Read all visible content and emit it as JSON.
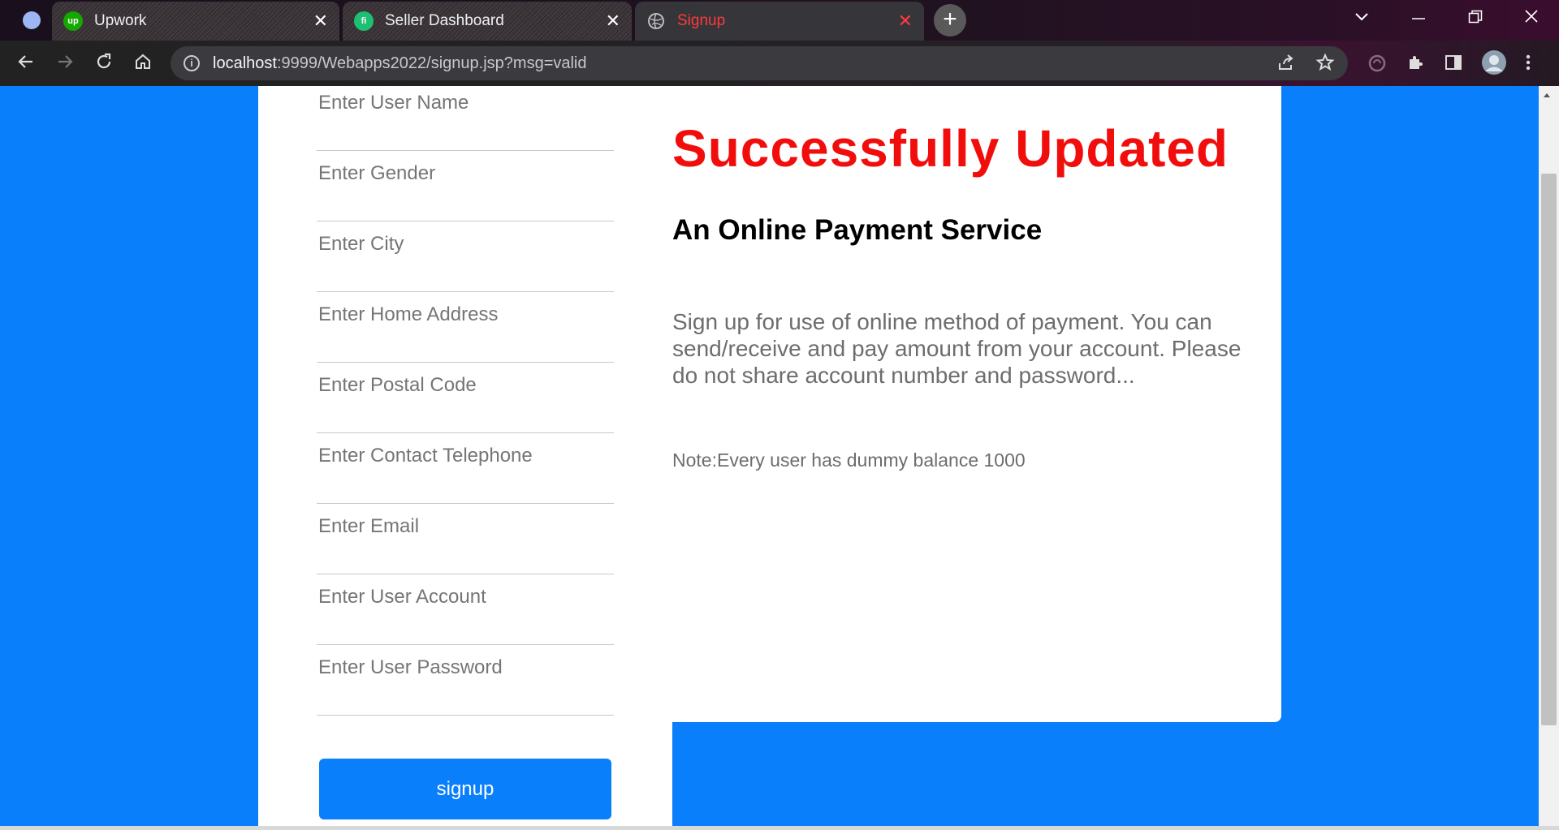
{
  "browser": {
    "tabs": [
      {
        "title": "Upwork",
        "favicon": "up"
      },
      {
        "title": "Seller Dashboard",
        "favicon": "fi"
      },
      {
        "title": "Signup",
        "favicon": "globe-icon"
      }
    ],
    "url_host": "localhost",
    "url_rest": ":9999/Webapps2022/signup.jsp?msg=valid",
    "tab_close_glyph": "✕",
    "new_tab_glyph": "+"
  },
  "form": {
    "fields": [
      {
        "placeholder": "Enter User Name"
      },
      {
        "placeholder": "Enter Gender"
      },
      {
        "placeholder": "Enter City"
      },
      {
        "placeholder": "Enter Home Address"
      },
      {
        "placeholder": "Enter Postal Code"
      },
      {
        "placeholder": "Enter Contact Telephone"
      },
      {
        "placeholder": "Enter Email"
      },
      {
        "placeholder": "Enter User Account"
      },
      {
        "placeholder": "Enter User Password"
      }
    ],
    "submit_label": "signup"
  },
  "info": {
    "status_heading": "Successfully Updated",
    "service_title": "An Online Payment Service",
    "description": "Sign up for use of online method of payment. You can send/receive and pay amount from your account. Please do not share account number and password...",
    "note": "Note:Every user has dummy balance 1000"
  },
  "colors": {
    "page_background": "#0a7ffb",
    "status_heading": "#f20d0d",
    "button": "#0a7ffb",
    "active_tab_title": "#ff3b3b"
  }
}
